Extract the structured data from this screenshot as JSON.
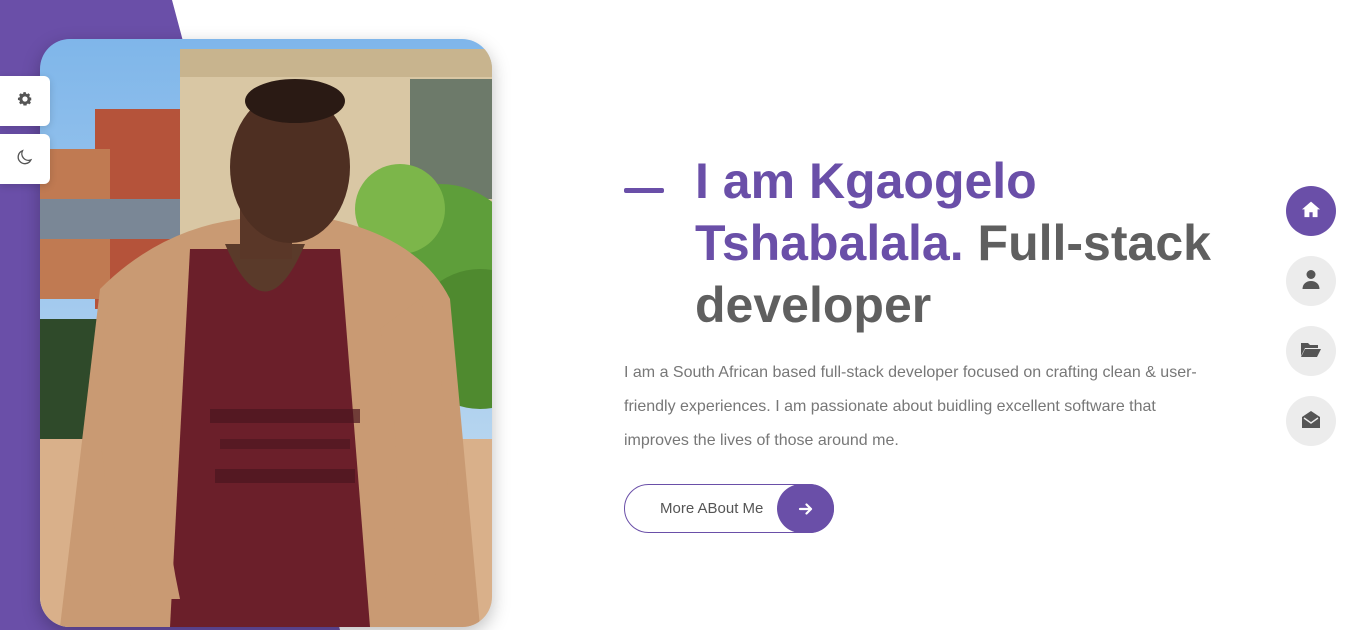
{
  "hero": {
    "heading_accent": "I am Kgaogelo Tshabalala.",
    "heading_rest": " Full-stack developer",
    "description": "I am a South African based full-stack developer focused on crafting clean & user-friendly experiences. I am passionate about buidling excellent software that improves the lives of those around me.",
    "cta_label": "More ABout Me"
  },
  "side_tools": [
    {
      "icon": "gear-icon"
    },
    {
      "icon": "moon-icon"
    }
  ],
  "nav": [
    {
      "icon": "home-icon",
      "active": true
    },
    {
      "icon": "user-icon",
      "active": false
    },
    {
      "icon": "folder-open-icon",
      "active": false
    },
    {
      "icon": "envelope-open-icon",
      "active": false
    }
  ],
  "colors": {
    "accent": "#6a4fa8",
    "heading_gray": "#5f5f5f",
    "text_gray": "#777777",
    "nav_inactive": "#ececec"
  }
}
